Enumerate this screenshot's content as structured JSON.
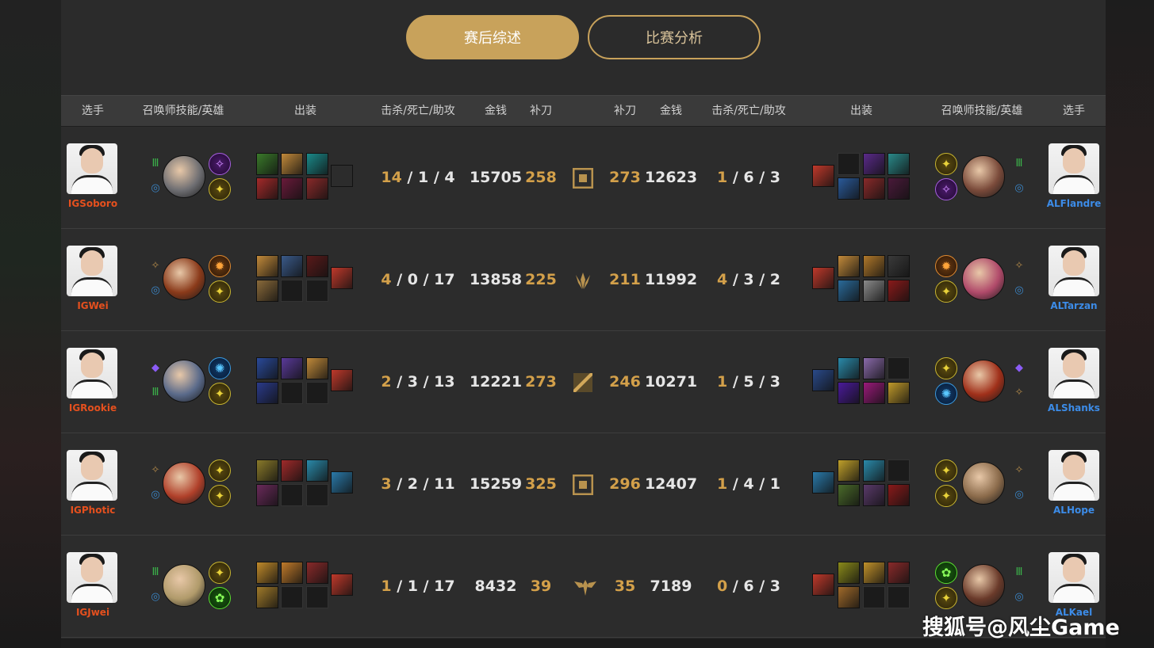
{
  "tabs": [
    {
      "label": "赛后综述",
      "active": true
    },
    {
      "label": "比赛分析",
      "active": false
    }
  ],
  "headers": {
    "player": "选手",
    "spells_champ": "召唤师技能/英雄",
    "items": "出装",
    "kda": "击杀/死亡/助攻",
    "gold": "金钱",
    "cs": "补刀"
  },
  "rows": [
    {
      "lane": "top",
      "left": {
        "name": "IGSoboro",
        "k": "14",
        "d": "1",
        "a": "4",
        "gold": "15705",
        "cs": "258",
        "spells": [
          "green",
          "blue"
        ],
        "runes": [
          "p",
          "y"
        ],
        "champ": "#6e6e72",
        "items": [
          "#3a7a2a",
          "#c28a3a",
          "#1a8a8a",
          "#a52a2a",
          "#6a1a3a",
          "#8a2a2a",
          "empty",
          "#c0392b"
        ]
      },
      "right": {
        "name": "ALFlandre",
        "k": "1",
        "d": "6",
        "a": "3",
        "gold": "12623",
        "cs": "273",
        "spells": [
          "green",
          "blue"
        ],
        "runes": [
          "y",
          "p"
        ],
        "champ": "#7a4a3a",
        "items": [
          "empty",
          "#5a2a8a",
          "#2a8a8a",
          "#2a5a9a",
          "#8a2a2a",
          "#4a1a3a",
          "#c0392b"
        ]
      }
    },
    {
      "lane": "jungle",
      "left": {
        "name": "IGWei",
        "k": "4",
        "d": "0",
        "a": "17",
        "gold": "13858",
        "cs": "225",
        "spells": [
          "gold",
          "blue"
        ],
        "runes": [
          "o",
          "y"
        ],
        "champ": "#8a3a1a",
        "items": [
          "#c28a3a",
          "#3a5a8a",
          "#5a1a1a",
          "#8a6a3a",
          "empty",
          "empty",
          "#c0392b"
        ]
      },
      "right": {
        "name": "ALTarzan",
        "k": "4",
        "d": "3",
        "a": "2",
        "gold": "11992",
        "cs": "211",
        "spells": [
          "gold",
          "blue"
        ],
        "runes": [
          "o",
          "y"
        ],
        "champ": "#b04a6a",
        "items": [
          "#c28a3a",
          "#b0782a",
          "#3a3a3a",
          "#2a6a9a",
          "#8a8a8a",
          "#8a1a1a",
          "#c0392b"
        ]
      }
    },
    {
      "lane": "mid",
      "left": {
        "name": "IGRookie",
        "k": "2",
        "d": "3",
        "a": "13",
        "gold": "12221",
        "cs": "273",
        "spells": [
          "purple",
          "green"
        ],
        "runes": [
          "b",
          "y"
        ],
        "champ": "#5a6a8a",
        "items": [
          "#2a4a9a",
          "#5a3a9a",
          "#c08a3a",
          "#2a3a8a",
          "empty",
          "empty",
          "#c0392b"
        ]
      },
      "right": {
        "name": "ALShanks",
        "k": "1",
        "d": "5",
        "a": "3",
        "gold": "10271",
        "cs": "246",
        "spells": [
          "purple",
          "gold"
        ],
        "runes": [
          "y",
          "b"
        ],
        "champ": "#a0301a",
        "items": [
          "#2a8aaa",
          "#8a6aaa",
          "empty",
          "#4a1a9a",
          "#9a1a7a",
          "#c09a2a",
          "#2a4a8a"
        ]
      }
    },
    {
      "lane": "bot",
      "left": {
        "name": "IGPhotic",
        "k": "3",
        "d": "2",
        "a": "11",
        "gold": "15259",
        "cs": "325",
        "spells": [
          "gold",
          "blue"
        ],
        "runes": [
          "y",
          "y"
        ],
        "champ": "#b0402a",
        "items": [
          "#8a7a2a",
          "#a02a2a",
          "#2a8aaa",
          "#6a2a5a",
          "empty",
          "empty",
          "#2a7aaa"
        ]
      },
      "right": {
        "name": "ALHope",
        "k": "1",
        "d": "4",
        "a": "1",
        "gold": "12407",
        "cs": "296",
        "spells": [
          "gold",
          "blue"
        ],
        "runes": [
          "y",
          "y"
        ],
        "champ": "#8a6a4a",
        "items": [
          "#c0a02a",
          "#2a8aaa",
          "empty",
          "#4a6a2a",
          "#5a3a6a",
          "#8a1a1a",
          "#2a7aaa"
        ]
      }
    },
    {
      "lane": "support",
      "left": {
        "name": "IGJwei",
        "k": "1",
        "d": "1",
        "a": "17",
        "gold": "8432",
        "cs": "39",
        "spells": [
          "green",
          "blue"
        ],
        "runes": [
          "y",
          "g"
        ],
        "champ": "#b09a6a",
        "items": [
          "#c08a2a",
          "#c07a2a",
          "#8a2a2a",
          "#a07a2a",
          "empty",
          "empty",
          "#c0392b"
        ]
      },
      "right": {
        "name": "ALKael",
        "k": "0",
        "d": "6",
        "a": "3",
        "gold": "7189",
        "cs": "35",
        "spells": [
          "green",
          "blue"
        ],
        "runes": [
          "g",
          "y"
        ],
        "champ": "#6a3a2a",
        "items": [
          "#8a8a1a",
          "#c0902a",
          "#8a2a2a",
          "#a06a2a",
          "empty",
          "empty",
          "#c0392b"
        ]
      }
    }
  ],
  "watermark": "搜狐号@风尘Game"
}
